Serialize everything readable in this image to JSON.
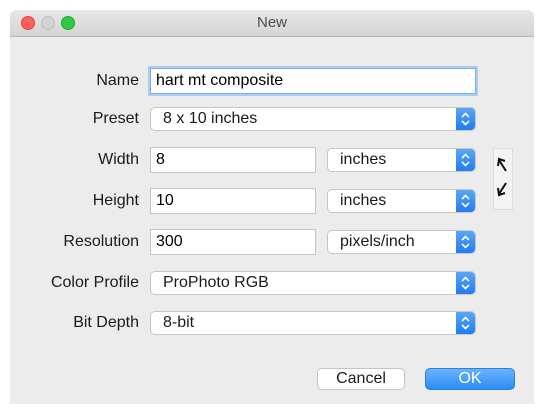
{
  "window": {
    "title": "New"
  },
  "form": {
    "name_label": "Name",
    "name_value": "hart mt composite",
    "preset_label": "Preset",
    "preset_value": "8 x 10 inches",
    "width_label": "Width",
    "width_value": "8",
    "width_unit": "inches",
    "height_label": "Height",
    "height_value": "10",
    "height_unit": "inches",
    "resolution_label": "Resolution",
    "resolution_value": "300",
    "resolution_unit": "pixels/inch",
    "color_profile_label": "Color Profile",
    "color_profile_value": "ProPhoto RGB",
    "bit_depth_label": "Bit Depth",
    "bit_depth_value": "8-bit"
  },
  "buttons": {
    "cancel_label": "Cancel",
    "ok_label": "OK"
  },
  "icons": {
    "close": "close-icon",
    "minimize": "minimize-icon",
    "zoom": "zoom-icon",
    "link": "swap-dimensions-icon",
    "popup": "chevron-up-down-icon"
  },
  "colors": {
    "accent": "#2c8cf4",
    "window_bg": "#ececec"
  }
}
